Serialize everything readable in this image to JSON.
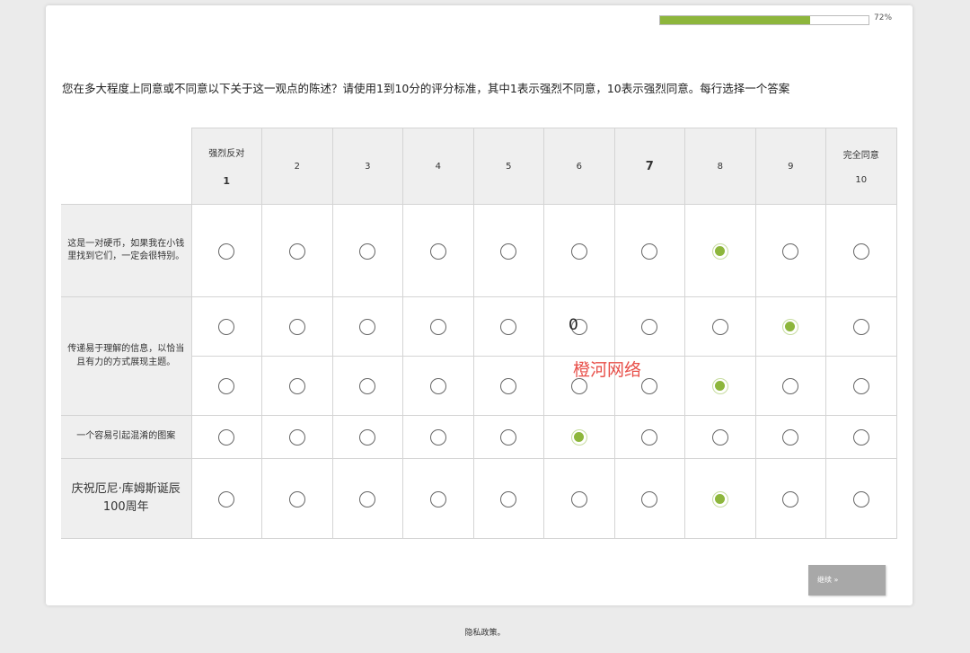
{
  "progress": {
    "percent_label": "72%",
    "fraction": 0.72
  },
  "question": "您在多大程度上同意或不同意以下关于这一观点的陈述？请使用1到10分的评分标准，其中1表示强烈不同意，10表示强烈同意。每行选择一个答案",
  "scale": {
    "left_anchor": "强烈反对",
    "right_anchor": "完全同意",
    "columns": [
      "1",
      "2",
      "3",
      "4",
      "5",
      "6",
      "7",
      "8",
      "9",
      "10"
    ]
  },
  "rows": [
    {
      "label": "这是一对硬币，如果我在小钱里找到它们，一定会很特别。",
      "selected": 8
    },
    {
      "label": "传递易于理解的信息，以恰当且有力的方式展现主题。",
      "selected": 9
    },
    {
      "label": "",
      "selected": 8
    },
    {
      "label": "一个容易引起混淆的图案",
      "selected": 6
    },
    {
      "label": "庆祝厄尼·库姆斯诞辰100周年",
      "selected": 8
    }
  ],
  "overlay": {
    "stray_text": "0",
    "watermark": "橙河网络"
  },
  "continue_button": "继续 »",
  "footer": {
    "privacy": "隐私政策。"
  },
  "colors": {
    "accent": "#8db63c",
    "header_bg": "#efefef",
    "button_bg": "#a8a8a8"
  }
}
